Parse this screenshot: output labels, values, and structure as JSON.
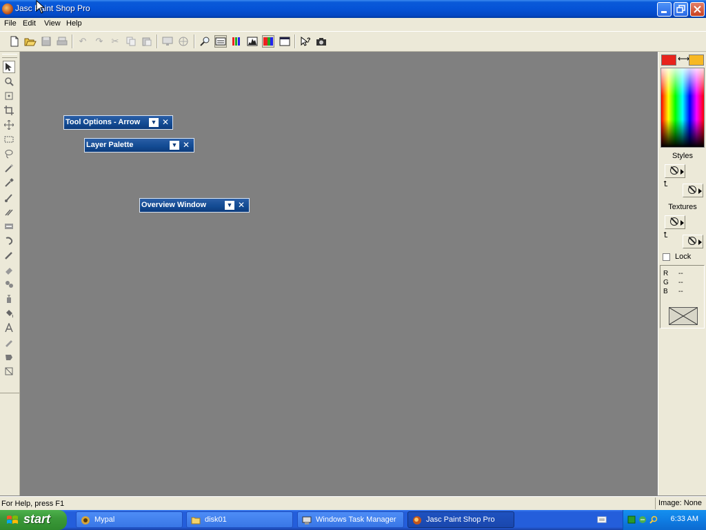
{
  "window": {
    "title": "Jasc Paint Shop Pro",
    "minimize": "_",
    "restore": "❐",
    "close": "✕"
  },
  "menu": [
    "File",
    "Edit",
    "View",
    "Help"
  ],
  "palettes": {
    "tool_options": "Tool Options - Arrow",
    "layer_palette": "Layer Palette",
    "overview_window": "Overview Window"
  },
  "color_panel": {
    "foreground_color": "#e8241c",
    "background_color": "#f7b824",
    "styles_label": "Styles",
    "textures_label": "Textures",
    "lock_label": "Lock",
    "lock_checked": false,
    "rgb": [
      {
        "label": "R",
        "value": "--"
      },
      {
        "label": "G",
        "value": "--"
      },
      {
        "label": "B",
        "value": "--"
      }
    ]
  },
  "status": {
    "help_text": "For Help, press F1",
    "image_info": "Image: None"
  },
  "taskbar": {
    "start": "start",
    "tasks": [
      {
        "label": "Mypal",
        "icon": "mypal-icon",
        "active": false
      },
      {
        "label": "disk01",
        "icon": "folder-icon",
        "active": false
      },
      {
        "label": "Windows Task Manager",
        "icon": "task-manager-icon",
        "active": false
      },
      {
        "label": "Jasc Paint Shop Pro",
        "icon": "paint-shop-pro-icon",
        "active": true
      }
    ],
    "clock": "6:33 AM"
  },
  "colors": {
    "title_blue": "#0553d6",
    "workspace_gray": "#808080",
    "panel_beige": "#ece9d8",
    "palette_title": "#124a92"
  }
}
